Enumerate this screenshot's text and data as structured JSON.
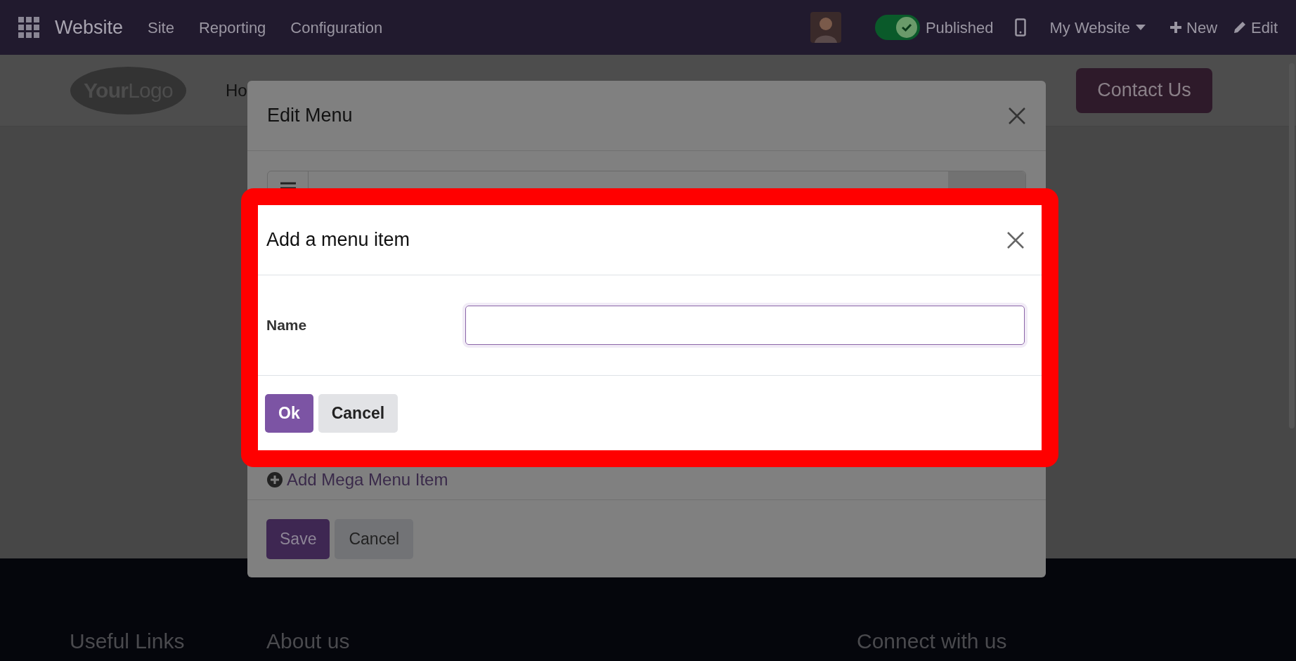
{
  "navbar": {
    "app": "Website",
    "menu": [
      "Site",
      "Reporting",
      "Configuration"
    ],
    "published": {
      "label": "Published",
      "on": true
    },
    "website": "My Website",
    "new": "New",
    "edit": "Edit"
  },
  "site_header": {
    "logo": [
      "Your",
      "Logo"
    ],
    "nav_partial": "Ho",
    "contact_button": "Contact Us"
  },
  "footer": {
    "headings": [
      "Useful Links",
      "About us",
      "Connect with us"
    ]
  },
  "edit_menu": {
    "title": "Edit Menu",
    "add_mega": "Add Mega Menu Item",
    "buttons": [
      "Save",
      "Cancel"
    ]
  },
  "add_dialog": {
    "title": "Add a menu item",
    "field_label": "Name",
    "buttons": [
      "Ok",
      "Cancel"
    ]
  }
}
